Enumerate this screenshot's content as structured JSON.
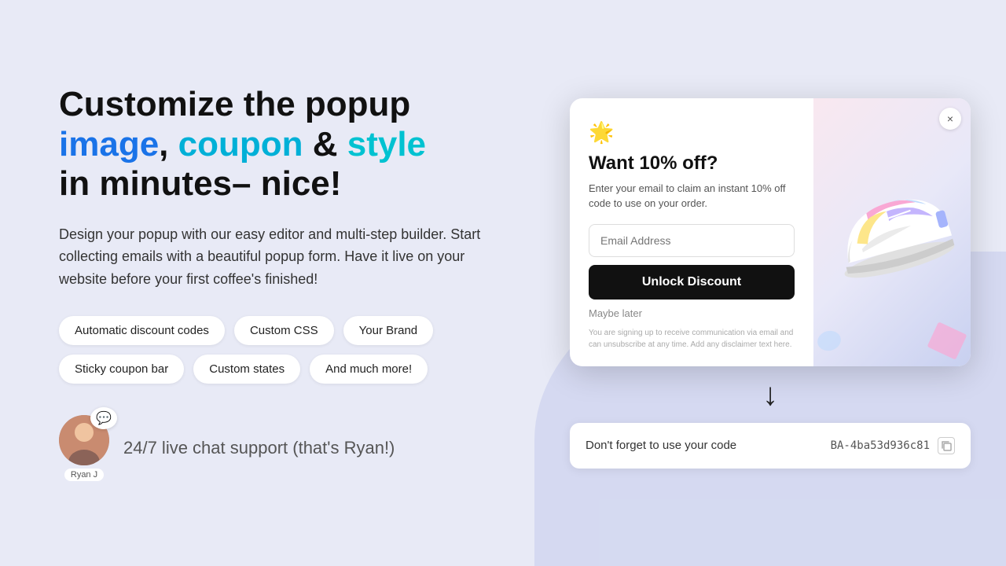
{
  "headline": {
    "line1": "Customize the popup",
    "highlight1": "image",
    "comma": ", ",
    "highlight2": "coupon",
    "and": " & ",
    "highlight3": "style",
    "line2": "in minutes– nice!"
  },
  "subtext": "Design your popup with our easy editor and multi-step builder. Start collecting emails with a beautiful popup form. Have it live on your website before your first coffee's finished!",
  "tags": [
    "Automatic discount codes",
    "Custom CSS",
    "Your Brand",
    "Sticky coupon bar",
    "Custom states",
    "And much more!"
  ],
  "support": {
    "avatar_emoji": "👤",
    "avatar_name": "Ryan J",
    "text": "24/7 live chat support ",
    "text_paren": "(that's Ryan!)"
  },
  "popup": {
    "icon": "⭐",
    "title": "Want 10% off?",
    "desc": "Enter your email to claim an instant 10% off code to use on your order.",
    "email_placeholder": "Email Address",
    "btn_label": "Unlock Discount",
    "maybe_label": "Maybe later",
    "disclaimer": "You are signing up to receive communication via email and can unsubscribe at any time. Add any disclaimer text here.",
    "close_label": "×"
  },
  "arrow": "↓",
  "coupon": {
    "text": "Don't forget to use your code",
    "code": "BA-4ba53d936c81",
    "copy_icon": "⧉"
  }
}
